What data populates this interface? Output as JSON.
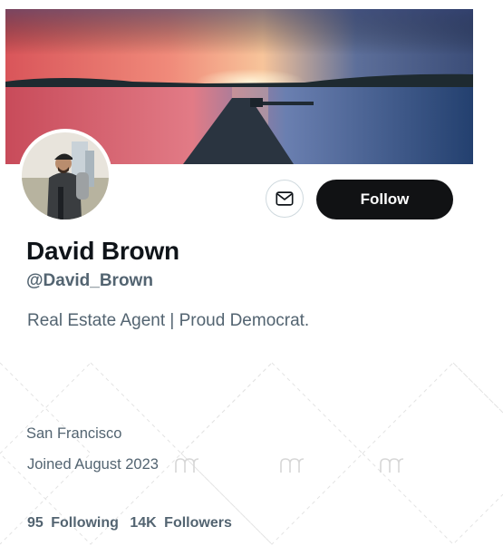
{
  "profile": {
    "name": "David Brown",
    "handle": "@David_Brown",
    "bio": "Real Estate Agent | Proud Democrat.",
    "location": "San Francisco",
    "joined": "Joined August 2023",
    "following_count": "95",
    "following_label": "Following",
    "followers_count": "14K",
    "followers_label": "Followers"
  },
  "actions": {
    "follow_label": "Follow",
    "message_icon": "mail-icon"
  },
  "colors": {
    "follow_bg": "#111214",
    "secondary_text": "#536471",
    "primary_text": "#0f1419"
  }
}
